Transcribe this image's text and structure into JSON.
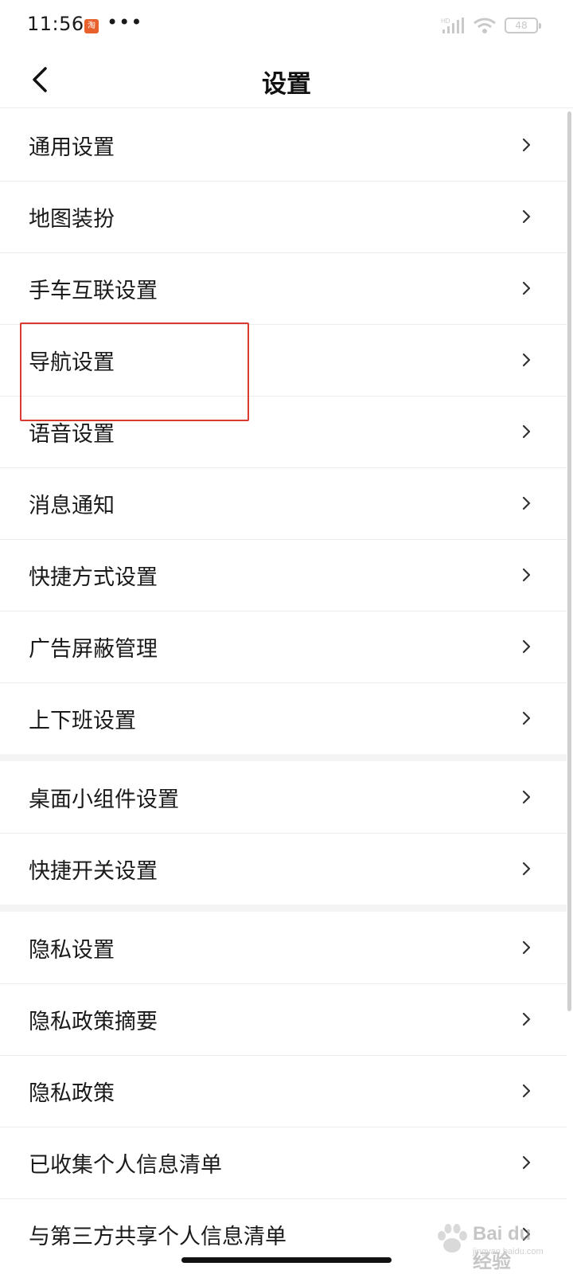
{
  "status_bar": {
    "time": "11:56",
    "app_icon_text": "淘",
    "more_dots": "•••",
    "battery_level": "48",
    "signal_icon": "signal-icon",
    "wifi_icon": "wifi-icon"
  },
  "header": {
    "title": "设置",
    "back_icon": "back-arrow-icon"
  },
  "settings": {
    "groups": [
      {
        "items": [
          {
            "label": "通用设置"
          },
          {
            "label": "地图装扮"
          },
          {
            "label": "手车互联设置"
          },
          {
            "label": "导航设置",
            "highlighted": true
          },
          {
            "label": "语音设置"
          },
          {
            "label": "消息通知"
          },
          {
            "label": "快捷方式设置"
          },
          {
            "label": "广告屏蔽管理"
          },
          {
            "label": "上下班设置"
          }
        ]
      },
      {
        "items": [
          {
            "label": "桌面小组件设置"
          },
          {
            "label": "快捷开关设置"
          }
        ]
      },
      {
        "items": [
          {
            "label": "隐私设置"
          },
          {
            "label": "隐私政策摘要"
          },
          {
            "label": "隐私政策"
          },
          {
            "label": "已收集个人信息清单"
          },
          {
            "label": "与第三方共享个人信息清单"
          }
        ]
      }
    ]
  },
  "colors": {
    "highlight_border": "#d9392f",
    "divider": "#ececec",
    "group_gap": "#f4f4f4"
  },
  "watermark": {
    "text": "Bai du 经验",
    "sub": "jingyan.baidu.com"
  }
}
